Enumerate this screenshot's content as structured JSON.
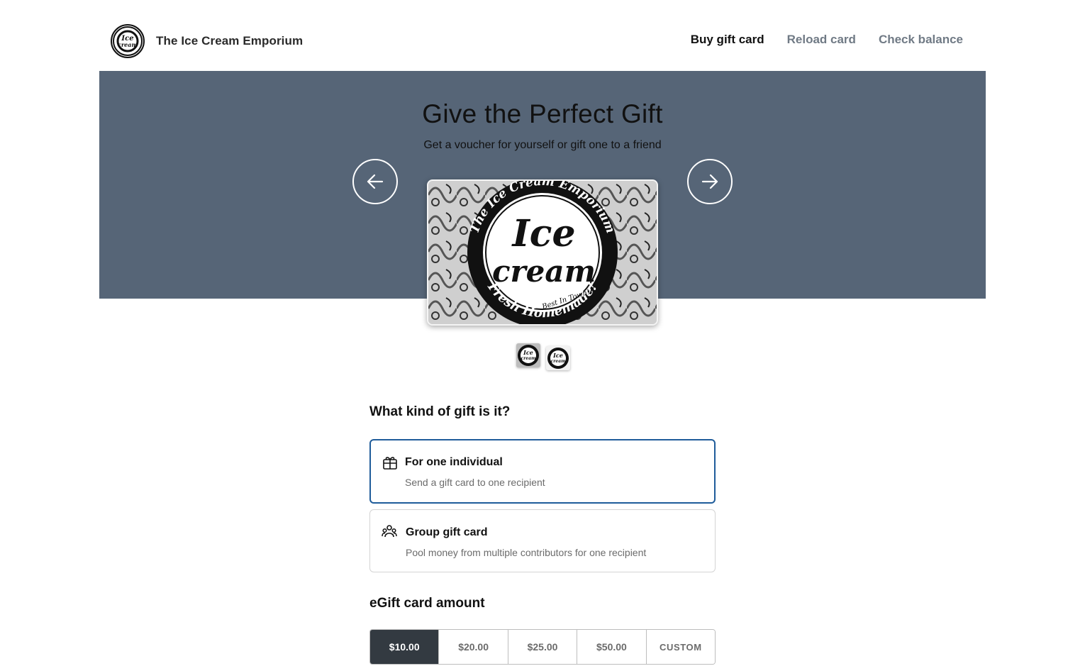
{
  "header": {
    "brand_name": "The Ice Cream Emporium",
    "logo_icon": "ice-cream-logo",
    "nav": [
      {
        "label": "Buy gift card",
        "active": true
      },
      {
        "label": "Reload card",
        "active": false
      },
      {
        "label": "Check balance",
        "active": false
      }
    ]
  },
  "hero": {
    "title": "Give the Perfect Gift",
    "subtitle": "Get a voucher for yourself or gift one to a friend",
    "background": "#566577",
    "prev_icon": "arrow-left-icon",
    "next_icon": "arrow-right-icon",
    "card_design": {
      "ring_top_text": "The Ice Cream Emporium",
      "ring_bottom_text": "Fresh Homemade!",
      "center_line1": "Ice",
      "center_line2": "cream",
      "tagline": "Best In Town!"
    },
    "thumbnails_count": 2,
    "selected_thumbnail": 0
  },
  "gift_kind": {
    "title": "What kind of gift is it?",
    "options": [
      {
        "title": "For one individual",
        "desc": "Send a gift card to one recipient",
        "icon": "gift-icon",
        "selected": true
      },
      {
        "title": "Group gift card",
        "desc": "Pool money from multiple contributors for one recipient",
        "icon": "group-icon",
        "selected": false
      }
    ]
  },
  "amount": {
    "title": "eGift card amount",
    "options": [
      "$10.00",
      "$20.00",
      "$25.00",
      "$50.00",
      "CUSTOM"
    ],
    "selected_index": 0
  },
  "colors": {
    "selected_border": "#1f5c9a",
    "selected_amount_bg": "#333a41"
  }
}
